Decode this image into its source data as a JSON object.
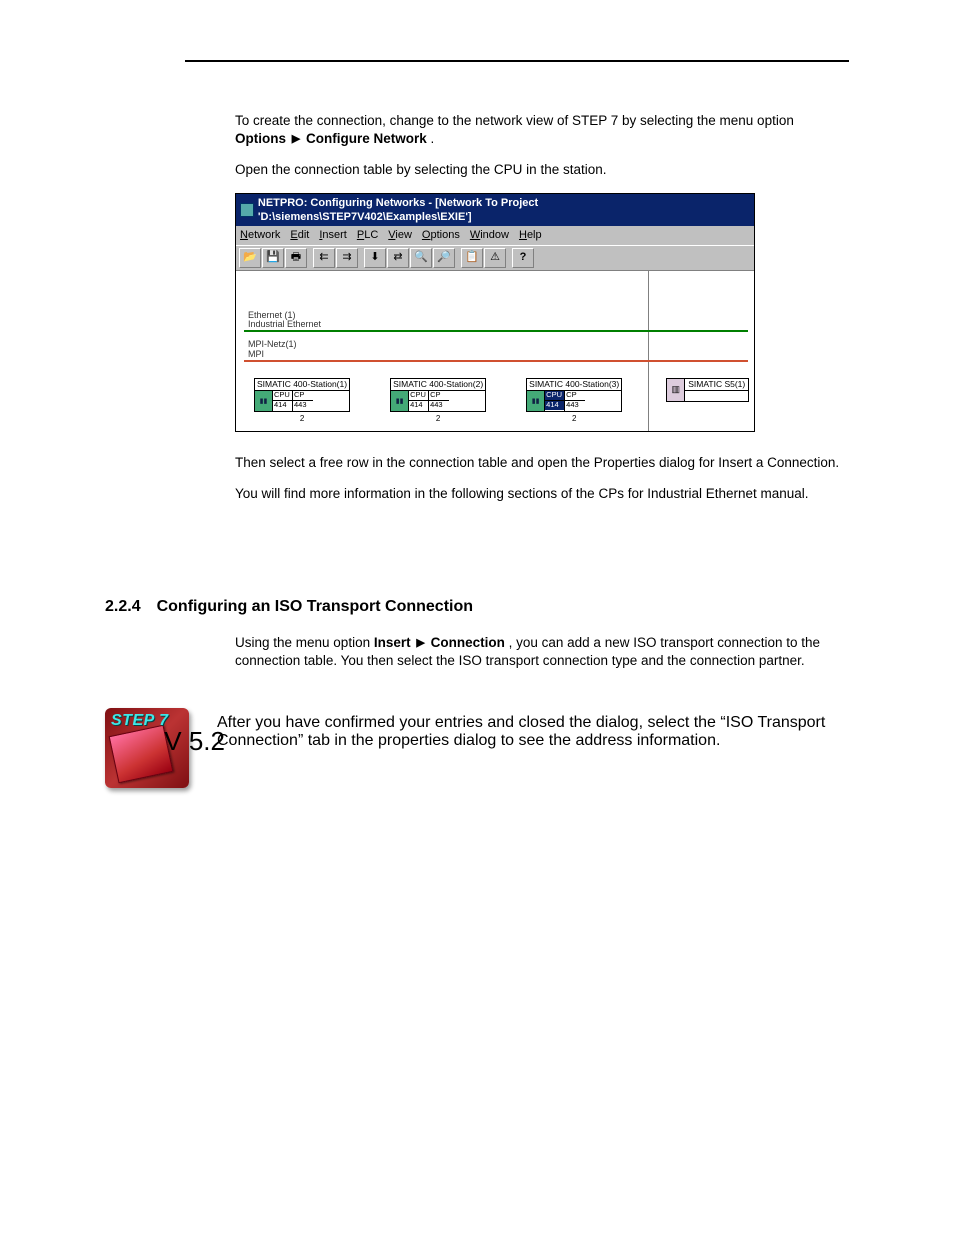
{
  "header": {
    "running_head_right": ""
  },
  "text": {
    "intro1_a": "To create the connection, change to the network view of STEP 7 by selecting the menu option ",
    "intro1_menu_a": "Options",
    "intro1_menu_b": "Configure Network",
    "intro1_b": ".",
    "intro2": "Open the connection table by selecting the CPU in the station.",
    "below_fig": "Then select a free row in the connection table and open the Properties dialog for Insert a Connection.",
    "more_info": "You will find more information in the following sections of the CPs for Industrial Ethernet manual.",
    "section_heading": "2.2.4 Configuring an ISO Transport Connection",
    "menu_path_a": "Insert",
    "menu_path_b": "Connection",
    "step7_lead_a": "Using the menu option ",
    "step7_lead_b": ", you can add a new ISO transport connection to the connection table. You then select the ISO transport connection type and the connection partner.",
    "followup": "After you have confirmed your entries and closed the dialog, select the “ISO Transport Connection” tab in the properties dialog to see the address information."
  },
  "netpro": {
    "title": "NETPRO: Configuring Networks - [Network To Project 'D:\\siemens\\STEP7V402\\Examples\\EXIE']",
    "menus": [
      "Network",
      "Edit",
      "Insert",
      "PLC",
      "View",
      "Options",
      "Window",
      "Help"
    ],
    "nets": {
      "ie_label1": "Ethernet (1)",
      "ie_label2": "Industrial Ethernet",
      "mpi_label1": "MPI-Netz(1)",
      "mpi_label2": "MPI"
    },
    "stations": [
      {
        "title": "SIMATIC 400-Station(1)",
        "slots": [
          {
            "t": "CPU",
            "b": "414"
          },
          {
            "t": "CP",
            "b": "443"
          }
        ],
        "num": "2",
        "sel": -1
      },
      {
        "title": "SIMATIC 400-Station(2)",
        "slots": [
          {
            "t": "CPU",
            "b": "414"
          },
          {
            "t": "CP",
            "b": "443"
          }
        ],
        "num": "2",
        "sel": -1
      },
      {
        "title": "SIMATIC 400-Station(3)",
        "slots": [
          {
            "t": "CPU",
            "b": "414"
          },
          {
            "t": "CP",
            "b": "443"
          }
        ],
        "num": "2",
        "sel": 0
      }
    ],
    "s5": {
      "title": "SIMATIC S5(1)"
    }
  },
  "icons": {
    "step7_brand": "STEP 7",
    "step7_version": "V 5.2"
  },
  "toolbar_glyphs": [
    "📂",
    "💾",
    "🖶",
    "",
    "",
    "🔌",
    "⇄",
    "",
    "",
    "📋",
    "⚠",
    "❓"
  ]
}
